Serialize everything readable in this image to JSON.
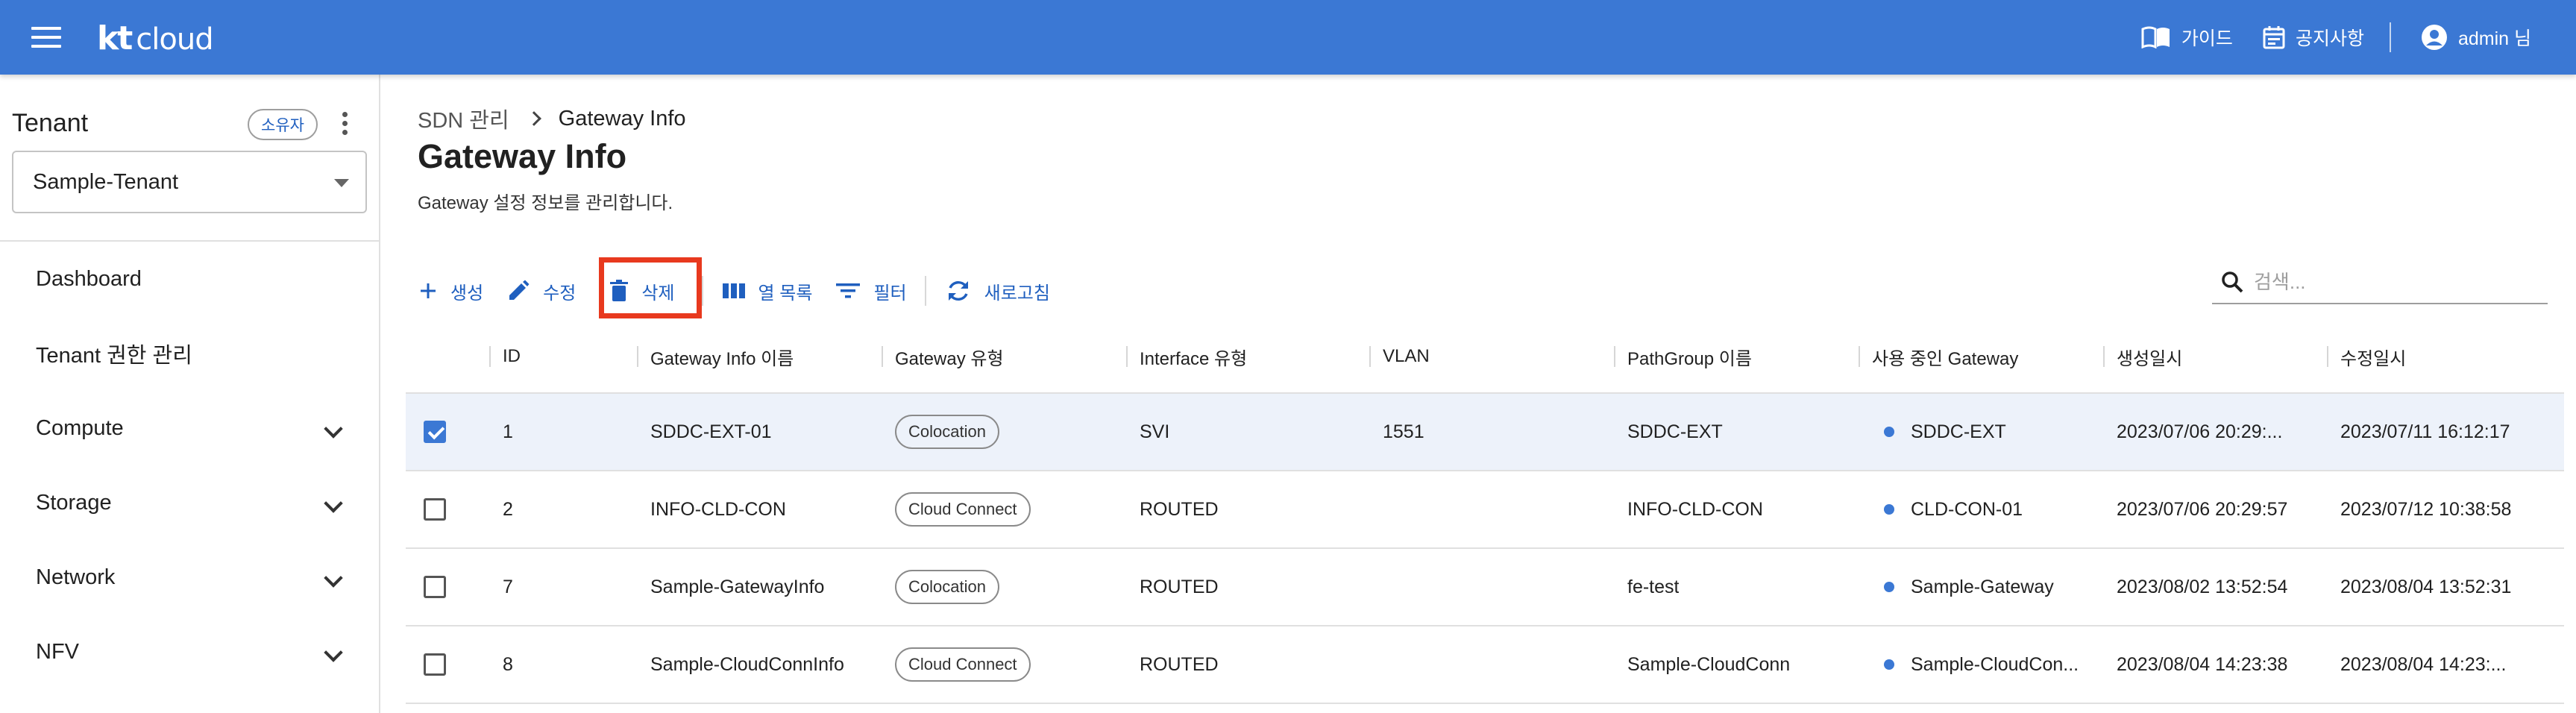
{
  "header": {
    "logo_kt": "kt",
    "logo_cloud": "cloud",
    "guide_label": "가이드",
    "notice_label": "공지사항",
    "user_label": "admin 님"
  },
  "sidebar": {
    "tenant_title": "Tenant",
    "owner_badge": "소유자",
    "tenant_select_value": "Sample-Tenant",
    "items": [
      {
        "label": "Dashboard",
        "expandable": false
      },
      {
        "label": "Tenant 권한 관리",
        "expandable": false
      },
      {
        "label": "Compute",
        "expandable": true
      },
      {
        "label": "Storage",
        "expandable": true
      },
      {
        "label": "Network",
        "expandable": true
      },
      {
        "label": "NFV",
        "expandable": true
      }
    ]
  },
  "breadcrumb": {
    "parent": "SDN 관리",
    "current": "Gateway Info"
  },
  "page": {
    "title": "Gateway Info",
    "description": "Gateway 설정 정보를 관리합니다."
  },
  "toolbar": {
    "create": "생성",
    "edit": "수정",
    "delete": "삭제",
    "columns": "열 목록",
    "filter": "필터",
    "refresh": "새로고침"
  },
  "search": {
    "placeholder": "검색..."
  },
  "table": {
    "columns": [
      "ID",
      "Gateway Info 이름",
      "Gateway 유형",
      "Interface 유형",
      "VLAN",
      "PathGroup 이름",
      "사용 중인 Gateway",
      "생성일시",
      "수정일시"
    ],
    "rows": [
      {
        "checked": true,
        "id": "1",
        "name": "SDDC-EXT-01",
        "type": "Colocation",
        "iface": "SVI",
        "vlan": "1551",
        "pathgroup": "SDDC-EXT",
        "gateway": "SDDC-EXT",
        "created": "2023/07/06 20:29:...",
        "modified": "2023/07/11 16:12:17"
      },
      {
        "checked": false,
        "id": "2",
        "name": "INFO-CLD-CON",
        "type": "Cloud Connect",
        "iface": "ROUTED",
        "vlan": "",
        "pathgroup": "INFO-CLD-CON",
        "gateway": "CLD-CON-01",
        "created": "2023/07/06 20:29:57",
        "modified": "2023/07/12 10:38:58"
      },
      {
        "checked": false,
        "id": "7",
        "name": "Sample-GatewayInfo",
        "type": "Colocation",
        "iface": "ROUTED",
        "vlan": "",
        "pathgroup": "fe-test",
        "gateway": "Sample-Gateway",
        "created": "2023/08/02 13:52:54",
        "modified": "2023/08/04 13:52:31"
      },
      {
        "checked": false,
        "id": "8",
        "name": "Sample-CloudConnInfo",
        "type": "Cloud Connect",
        "iface": "ROUTED",
        "vlan": "",
        "pathgroup": "Sample-CloudConn",
        "gateway": "Sample-CloudCon...",
        "created": "2023/08/04 14:23:38",
        "modified": "2023/08/04 14:23:..."
      }
    ]
  },
  "colors": {
    "primary": "#3b78d4",
    "highlight": "#e8391e",
    "selected_row": "#edf2fa"
  }
}
